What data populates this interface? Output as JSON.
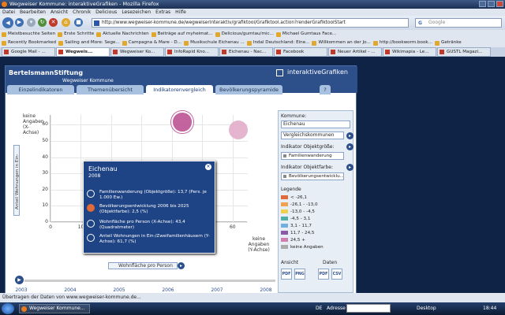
{
  "window": {
    "title": "Wegweiser Kommune: interaktiveGrafiken - Mozilla Firefox"
  },
  "menu": [
    "Datei",
    "Bearbeiten",
    "Ansicht",
    "Chronik",
    "Delicious",
    "Lesezeichen",
    "Extras",
    "Hilfe"
  ],
  "nav": {
    "url": "http://www.wegweiser-kommune.de/wegweiserinteraktiv/grafiktool/Grafiktool.action?renderGrafiktoolStart",
    "search_placeholder": "Google"
  },
  "bookmarks1": [
    "Meistbesuchte Seiten",
    "Erste Schritte",
    "Aktuelle Nachrichten",
    "Beiträge auf myheimat...",
    "Delicious/gumtau/mic...",
    "Michael Gumtaus Face..."
  ],
  "bookmarks2": [
    "Recently Bookmarked",
    "Sailing and More: Sege...",
    "Campagna & Mare - D...",
    "Musikschule Eichenau ...",
    "Indal Deutschland: Eine...",
    "Willkommen an der Jo...",
    "http://bookworm.book...",
    "Getränke"
  ],
  "tabs": [
    "Google Mail - ...",
    "Wegweis...",
    "Wegweiser Ko...",
    "InfoRapid Kno...",
    "Eichenau - Nac...",
    "Facebook",
    "Neuer Artikel - ...",
    "Wikimapia - Le...",
    "GUSTL Magazi..."
  ],
  "tabs_active": 1,
  "app": {
    "brand_left": "BertelsmannStiftung",
    "brand_sub": "Wegweiser Kommune",
    "brand_right": "interaktiveGrafiken",
    "tabs": [
      "Einzelindikatoren",
      "Themenübersicht",
      "Indikatorenvergleich",
      "Bevölkerungspyramide"
    ],
    "active_tab": 2,
    "help": "?"
  },
  "chart_data": {
    "type": "scatter",
    "title": "",
    "xlabel": "Wohnfläche pro Person",
    "ylabel": "Anteil Wohnungen in Ein-",
    "x_ticks": [
      0,
      10,
      20,
      30,
      40,
      50,
      60
    ],
    "y_ticks": [
      0,
      10,
      20,
      30,
      40,
      50,
      60
    ],
    "xlim": [
      0,
      65
    ],
    "ylim": [
      0,
      66
    ],
    "y_na_label": "keine Angaben (X-Achse)",
    "x_na_label": "keine Angaben (Y-Achse)",
    "series": [
      {
        "x": 43.4,
        "y": 61.7,
        "size": 13.7,
        "color": "#b94a8f"
      },
      {
        "x": 62,
        "y": 57,
        "size": 12,
        "color": "#e0a8c8"
      }
    ]
  },
  "popup": {
    "title": "Eichenau",
    "year": "2008",
    "rows": [
      "Familienwanderung (Objektgröße): 13,7 (Pers. je 1.000 Ew.)",
      "Bevölkerungsentwicklung 2006 bis 2025 (Objektfarbe): 2,5 (%)",
      "Wohnfläche pro Person (X-Achse): 43,4 (Quadratmeter)",
      "Anteil Wohnungen in Ein-/Zweifamilienhäusern (Y-Achse): 61,7 (%)"
    ]
  },
  "side": {
    "kommune_label": "Kommune:",
    "kommune_value": "Eichenau",
    "vergleich": "Vergleichskommunen",
    "size_label": "Indikator Objektgröße:",
    "size_value": "Familienwanderung",
    "color_label": "Indikator Objektfarbe:",
    "color_value": "Bevölkerungsentwicklu...",
    "legend_title": "Legende",
    "legend": [
      {
        "label": "< -26,1",
        "color": "#e06a3a"
      },
      {
        "label": "-26,1 - -13,0",
        "color": "#f0a050"
      },
      {
        "label": "-13,0 - -4,5",
        "color": "#f0d050"
      },
      {
        "label": "-4,5 - 3,1",
        "color": "#50b0a8"
      },
      {
        "label": "3,1 - 11,7",
        "color": "#70b0e0"
      },
      {
        "label": "11,7 - 24,5",
        "color": "#8a5aa8"
      },
      {
        "label": "24,5 +",
        "color": "#d080b0"
      },
      {
        "label": "keine Angaben",
        "color": "#aaaaaa"
      }
    ],
    "ansicht": "Ansicht",
    "daten": "Daten",
    "export_icons": [
      "PDF",
      "PNG",
      "PDF",
      "CSV"
    ]
  },
  "timeline": {
    "years": [
      "2003",
      "2004",
      "2005",
      "2006",
      "2007",
      "2008"
    ]
  },
  "status": "Übertragen der Daten von www.wegweiser-kommune.de...",
  "taskbar": {
    "firefox": "Wegweiser Kommune...",
    "lang": "DE",
    "addr": "Adresse",
    "desktop": "Desktop",
    "time": "18:44"
  }
}
